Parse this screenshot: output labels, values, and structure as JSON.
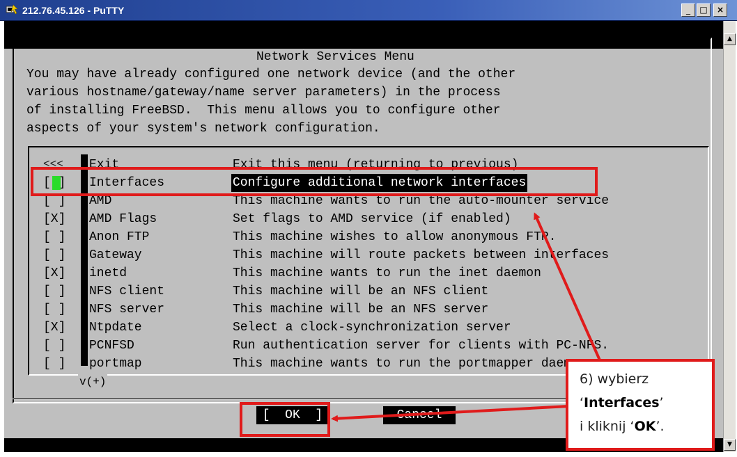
{
  "window": {
    "title": "212.76.45.126 - PuTTY",
    "minimize_label": "_",
    "maximize_label": "□",
    "close_label": "×"
  },
  "scrollbar": {
    "up_label": "▲",
    "down_label": "▼"
  },
  "dialog": {
    "title": "Network Services Menu",
    "description": [
      "You may have already configured one network device (and the other",
      "various hostname/gateway/name server parameters) in the process",
      "of installing FreeBSD.  This menu allows you to configure other",
      "aspects of your system's network configuration."
    ],
    "more_top": "<<<",
    "more_bottom": "v(+)",
    "items": [
      {
        "check": "   ",
        "name": "Exit",
        "desc": "Exit this menu (returning to previous)"
      },
      {
        "check": "[ ]",
        "name": "Interfaces",
        "desc": "Configure additional network interfaces",
        "selected": true
      },
      {
        "check": "[ ]",
        "name": "AMD",
        "desc": "This machine wants to run the auto-mounter service"
      },
      {
        "check": "[X]",
        "name": "AMD Flags",
        "desc": "Set flags to AMD service (if enabled)"
      },
      {
        "check": "[ ]",
        "name": "Anon FTP",
        "desc": "This machine wishes to allow anonymous FTP."
      },
      {
        "check": "[ ]",
        "name": "Gateway",
        "desc": "This machine will route packets between interfaces"
      },
      {
        "check": "[X]",
        "name": "inetd",
        "desc": "This machine wants to run the inet daemon"
      },
      {
        "check": "[ ]",
        "name": "NFS client",
        "desc": "This machine will be an NFS client"
      },
      {
        "check": "[ ]",
        "name": "NFS server",
        "desc": "This machine will be an NFS server"
      },
      {
        "check": "[X]",
        "name": "Ntpdate",
        "desc": "Select a clock-synchronization server"
      },
      {
        "check": "[ ]",
        "name": "PCNFSD",
        "desc": "Run authentication server for clients with PC-NFS."
      },
      {
        "check": "[ ]",
        "name": "portmap",
        "desc": "This machine wants to run the portmapper daemon"
      }
    ],
    "ok_label": "[  OK  ]",
    "cancel_label": "Cancel"
  },
  "annotation": {
    "line1": "6) wybierz",
    "line2_q1": "‘",
    "line2_bold": "Interfaces",
    "line2_q2": "’",
    "line3_pre": "i kliknij ‘",
    "line3_bold": "OK",
    "line3_post": "’."
  },
  "colors": {
    "terminal_bg": "#bfbfbf",
    "highlight": "#e01b1b",
    "cursor": "#2bdc2b"
  }
}
